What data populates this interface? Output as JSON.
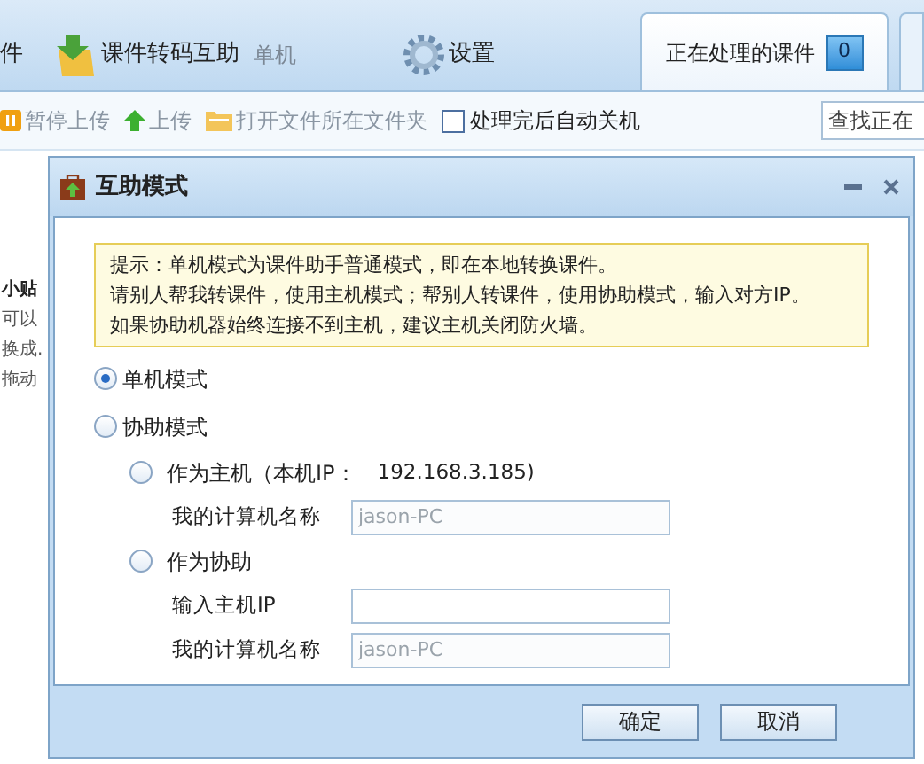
{
  "menu": {
    "items": [
      {
        "kind": "text",
        "label": "件"
      },
      {
        "kind": "convert",
        "label": "课件转码互助",
        "note": "单机"
      },
      {
        "kind": "settings",
        "label": "设置"
      }
    ]
  },
  "tabs": [
    {
      "label": "正在处理的课件",
      "badge": "0",
      "selected": true
    }
  ],
  "toolbar": {
    "items": [
      {
        "kind": "pause",
        "label": "暂停上传"
      },
      {
        "kind": "upload",
        "label": "上传"
      },
      {
        "kind": "folder",
        "label": "打开文件所在文件夹"
      },
      {
        "kind": "checkbox",
        "label": "处理完后自动关机",
        "checked": false
      }
    ],
    "search": {
      "placeholder": "查找正在"
    }
  },
  "background_text": [
    {
      "text": "小贴",
      "bold": true
    },
    {
      "text": "可以",
      "bold": false
    },
    {
      "text": "换成.",
      "bold": false
    },
    {
      "text": "拖动",
      "bold": false
    }
  ],
  "dialog": {
    "title": "互助模式",
    "hint": [
      "提示：单机模式为课件助手普通模式，即在本地转换课件。",
      "请别人帮我转课件，使用主机模式；帮别人转课件，使用协助模式，输入对方IP。",
      "如果协助机器始终连接不到主机，建议主机关闭防火墙。"
    ],
    "modes": [
      {
        "label": "单机模式",
        "selected": true
      },
      {
        "label": "协助模式",
        "selected": false
      }
    ],
    "roles": [
      {
        "label": "作为主机（本机IP：",
        "ip": "192.168.3.185)",
        "selected": false,
        "fields": [
          {
            "label": "我的计算机名称",
            "value": "jason-PC",
            "disabled": true
          }
        ]
      },
      {
        "label": "作为协助",
        "selected": false,
        "fields": [
          {
            "label": "输入主机IP"
          },
          {
            "label": "我的计算机名称",
            "value": "jason-PC",
            "disabled": true
          }
        ]
      }
    ],
    "buttons": [
      "确定",
      "取消"
    ]
  }
}
